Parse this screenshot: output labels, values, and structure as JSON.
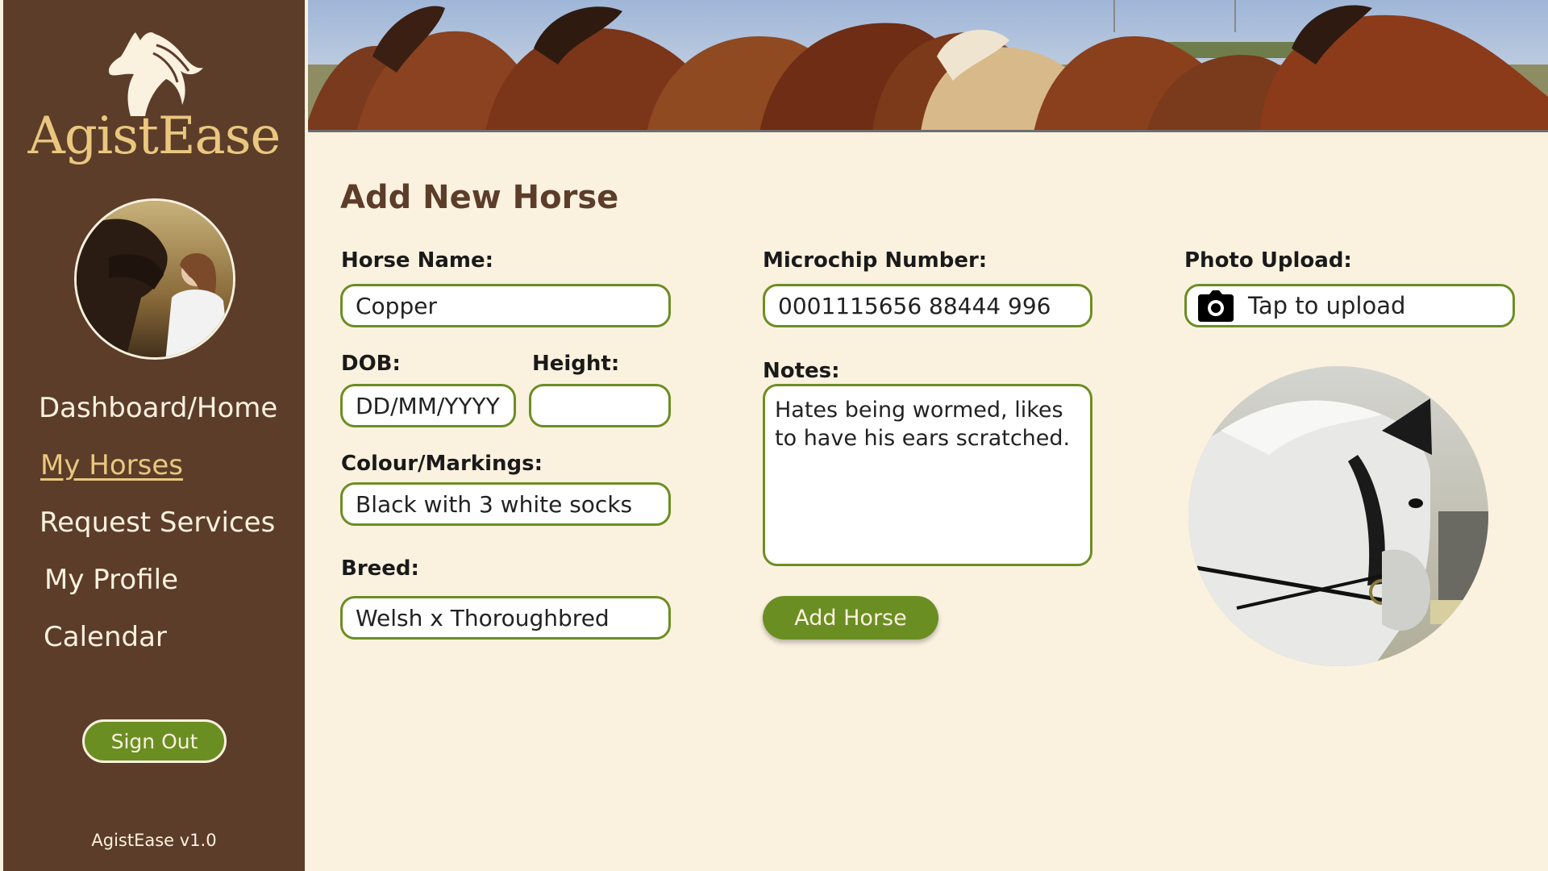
{
  "app": {
    "name": "AgistEase",
    "version": "AgistEase v1.0"
  },
  "sidebar": {
    "nav": [
      {
        "label": "Dashboard/Home",
        "active": false
      },
      {
        "label": "My Horses",
        "active": true
      },
      {
        "label": "Request Services",
        "active": false
      },
      {
        "label": "My Profile",
        "active": false
      },
      {
        "label": "Calendar",
        "active": false
      }
    ],
    "sign_out_label": "Sign Out"
  },
  "form": {
    "title": "Add New Horse",
    "horse_name": {
      "label": "Horse Name:",
      "value": "Copper"
    },
    "dob": {
      "label": "DOB:",
      "placeholder": "DD/MM/YYYY",
      "value": ""
    },
    "height": {
      "label": "Height:",
      "value": ""
    },
    "colour": {
      "label": "Colour/Markings:",
      "value": "Black with 3 white socks"
    },
    "breed": {
      "label": "Breed:",
      "value": "Welsh x Thoroughbred"
    },
    "microchip": {
      "label": "Microchip Number:",
      "value": "0001115656 88444 996"
    },
    "notes": {
      "label": "Notes:",
      "value": "Hates being wormed, likes to have his ears scratched."
    },
    "photo_upload": {
      "label": "Photo Upload:",
      "button_text": "Tap to upload",
      "icon": "camera-icon"
    },
    "submit_label": "Add Horse"
  },
  "colors": {
    "sidebar_bg": "#5c3d29",
    "page_bg": "#faf1df",
    "accent_green": "#6b8e23",
    "logo_gold": "#e9c77f"
  }
}
